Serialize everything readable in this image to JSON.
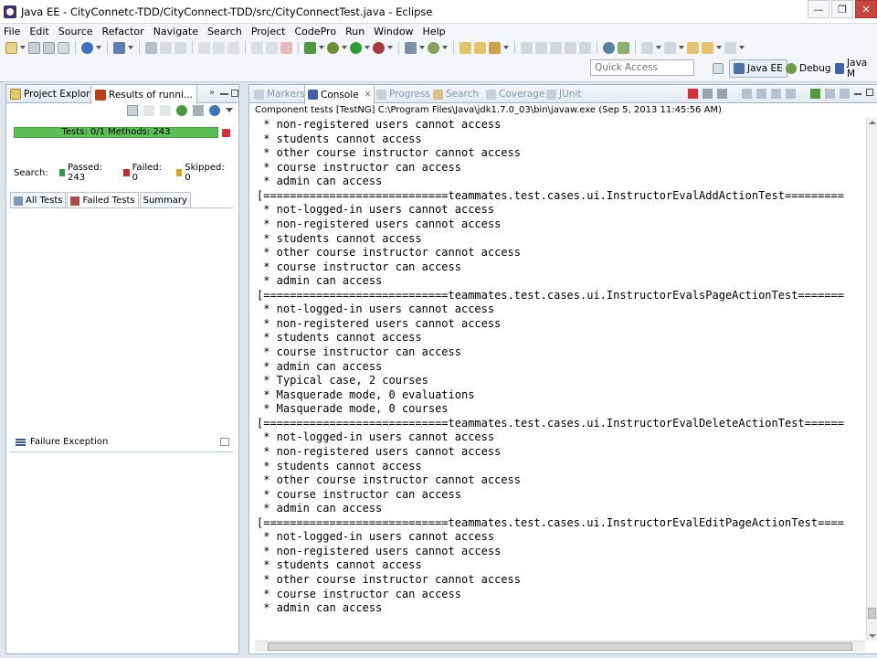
{
  "window": {
    "title": "Java EE - CityConnetc-TDD/CityConnect-TDD/src/CityConnectTest.java - Eclipse",
    "minimize_glyph": "—",
    "restore_glyph": "❐",
    "close_glyph": "✕"
  },
  "menu": [
    "File",
    "Edit",
    "Source",
    "Refactor",
    "Navigate",
    "Search",
    "Project",
    "CodePro",
    "Run",
    "Window",
    "Help"
  ],
  "quick_access": {
    "placeholder": "Quick Access"
  },
  "perspectives": {
    "java_ee": "Java EE",
    "debug": "Debug",
    "java": "Java M"
  },
  "left_panel": {
    "tab_project_explorer": "Project Explorer",
    "tab_results": "Results of runni...",
    "tab_overflow": "»",
    "progress_text": "Tests: 0/1  Methods: 243",
    "search_label": "Search:",
    "passed": "Passed: 243",
    "failed": "Failed: 0",
    "skipped": "Skipped: 0",
    "view_tabs": [
      "All Tests",
      "Failed Tests",
      "Summary"
    ],
    "failure_header": "Failure Exception"
  },
  "console_panel": {
    "tabs": [
      "Markers",
      "Console",
      "Progress",
      "Search",
      "Coverage",
      "JUnit"
    ],
    "description": "Component tests [TestNG] C:\\Program Files\\Java\\jdk1.7.0_03\\bin\\javaw.exe (Sep 5, 2013 11:45:56 AM)",
    "lines": [
      " * non-registered users cannot access",
      " * students cannot access",
      " * other course instructor cannot access",
      " * course instructor can access",
      " * admin can access",
      "[============================teammates.test.cases.ui.InstructorEvalAddActionTest=========",
      " * not-logged-in users cannot access",
      " * non-registered users cannot access",
      " * students cannot access",
      " * other course instructor cannot access",
      " * course instructor can access",
      " * admin can access",
      "[============================teammates.test.cases.ui.InstructorEvalsPageActionTest=======",
      " * not-logged-in users cannot access",
      " * non-registered users cannot access",
      " * students cannot access",
      " * course instructor can access",
      " * admin can access",
      " * Typical case, 2 courses",
      " * Masquerade mode, 0 evaluations",
      " * Masquerade mode, 0 courses",
      "[============================teammates.test.cases.ui.InstructorEvalDeleteActionTest======",
      " * not-logged-in users cannot access",
      " * non-registered users cannot access",
      " * students cannot access",
      " * other course instructor cannot access",
      " * course instructor can access",
      " * admin can access",
      "[============================teammates.test.cases.ui.InstructorEvalEditPageActionTest====",
      " * not-logged-in users cannot access",
      " * non-registered users cannot access",
      " * students cannot access",
      " * other course instructor cannot access",
      " * course instructor can access",
      " * admin can access"
    ]
  },
  "colors": {
    "progress_green": "#5cbf56",
    "stop_red": "#d8303b",
    "passed_green": "#2e9e3e",
    "failed_red": "#cc2b2b",
    "skipped_yellow": "#d8a51c"
  }
}
